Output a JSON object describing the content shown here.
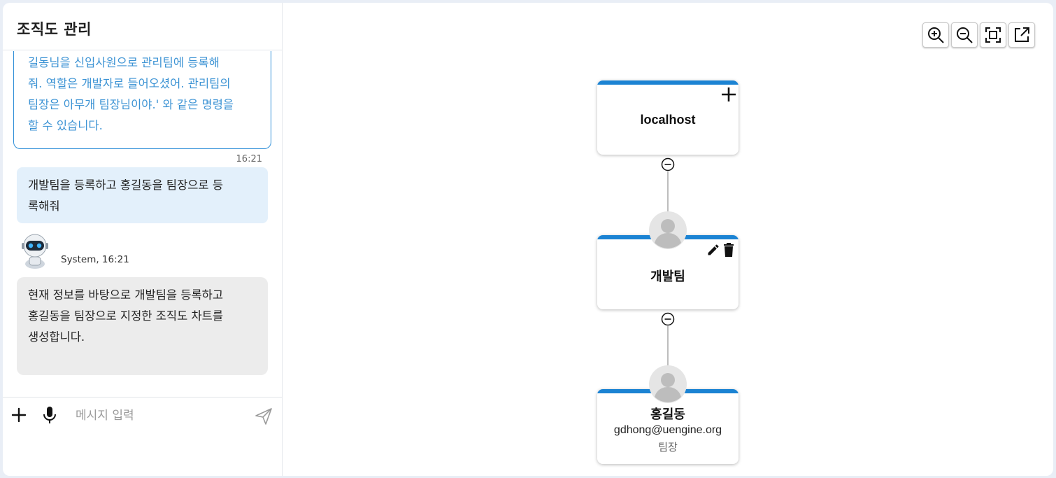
{
  "chat": {
    "title": "조직도 관리",
    "messages": {
      "prev_line1": "길동님을 신입사원으로 관리팀에 등록해",
      "prev_line2": "줘. 역할은 개발자로 들어오셨어. 관리팀의",
      "prev_line3": "팀장은 아무개 팀장님이야.' 와 같은 명령을",
      "prev_line4": "할 수 있습니다.",
      "user_time": "16:21",
      "user_line1": "개발팀을 등록하고 홍길동을 팀장으로 등",
      "user_line2": "록해줘",
      "bot_meta": "System, 16:21",
      "bot_line1": "현재 정보를 바탕으로 개발팀을 등록하고",
      "bot_line2": "홍길동을 팀장으로 지정한 조직도 차트를",
      "bot_line3": "생성합니다."
    },
    "input": {
      "placeholder": "메시지 입력"
    }
  },
  "org": {
    "root": {
      "name": "localhost"
    },
    "team": {
      "name": "개발팀"
    },
    "person": {
      "name": "홍길동",
      "email": "gdhong@uengine.org",
      "role": "팀장"
    }
  },
  "colors": {
    "accent": "#1b83d3",
    "user_bubble": "#e3f0fb",
    "bot_bubble": "#ececec"
  },
  "icons": [
    "zoom-in-icon",
    "zoom-out-icon",
    "fit-screen-icon",
    "open-external-icon",
    "plus-icon",
    "mic-icon",
    "send-icon",
    "edit-icon",
    "delete-icon",
    "collapse-icon",
    "avatar-icon",
    "robot-icon"
  ]
}
